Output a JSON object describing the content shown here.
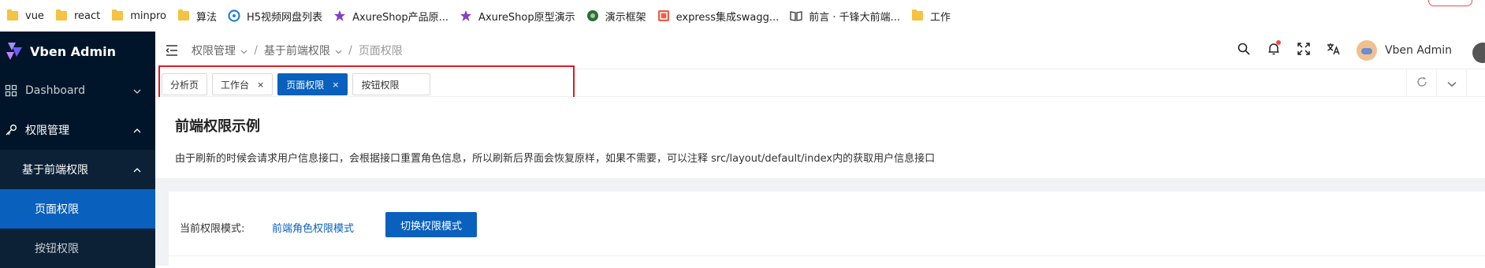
{
  "bookmarks": [
    {
      "label": "vue",
      "icon": "folder-icon"
    },
    {
      "label": "react",
      "icon": "folder-icon"
    },
    {
      "label": "minpro",
      "icon": "folder-icon"
    },
    {
      "label": "算法",
      "icon": "folder-icon"
    },
    {
      "label": "H5视频网盘列表",
      "icon": "site-icon"
    },
    {
      "label": "AxureShop产品原...",
      "icon": "axure-icon"
    },
    {
      "label": "AxureShop原型演示",
      "icon": "axure-icon"
    },
    {
      "label": "演示框架",
      "icon": "site-icon"
    },
    {
      "label": "express集成swagg...",
      "icon": "jianshu-icon"
    },
    {
      "label": "前言 · 千锋大前端...",
      "icon": "book-icon"
    },
    {
      "label": "工作",
      "icon": "folder-icon"
    }
  ],
  "app": {
    "name": "Vben Admin"
  },
  "sidebar": {
    "items": [
      {
        "label": "Dashboard"
      },
      {
        "label": "权限管理"
      },
      {
        "label": "基于前端权限"
      },
      {
        "label": "页面权限"
      },
      {
        "label": "按钮权限"
      }
    ]
  },
  "breadcrumb": [
    "权限管理",
    "基于前端权限",
    "页面权限"
  ],
  "user": {
    "name": "Vben Admin"
  },
  "tabs": [
    {
      "label": "分析页",
      "closable": false,
      "active": false
    },
    {
      "label": "工作台",
      "closable": true,
      "active": false
    },
    {
      "label": "页面权限",
      "closable": true,
      "active": true
    },
    {
      "label": "按钮权限",
      "closable": false,
      "active": false
    }
  ],
  "tab_close_glyph": "×",
  "page": {
    "title": "前端权限示例",
    "description": "由于刷新的时候会请求用户信息接口，会根据接口重置角色信息，所以刷新后界面会恢复原样，如果不需要，可以注释 src/layout/default/index内的获取用户信息接口",
    "mode_label": "当前权限模式:",
    "mode_value": "前端角色权限模式",
    "switch_button": "切换权限模式"
  },
  "colors": {
    "primary": "#0960bd",
    "sidebar_bg": "#001529",
    "highlight_box": "#e01b24"
  }
}
